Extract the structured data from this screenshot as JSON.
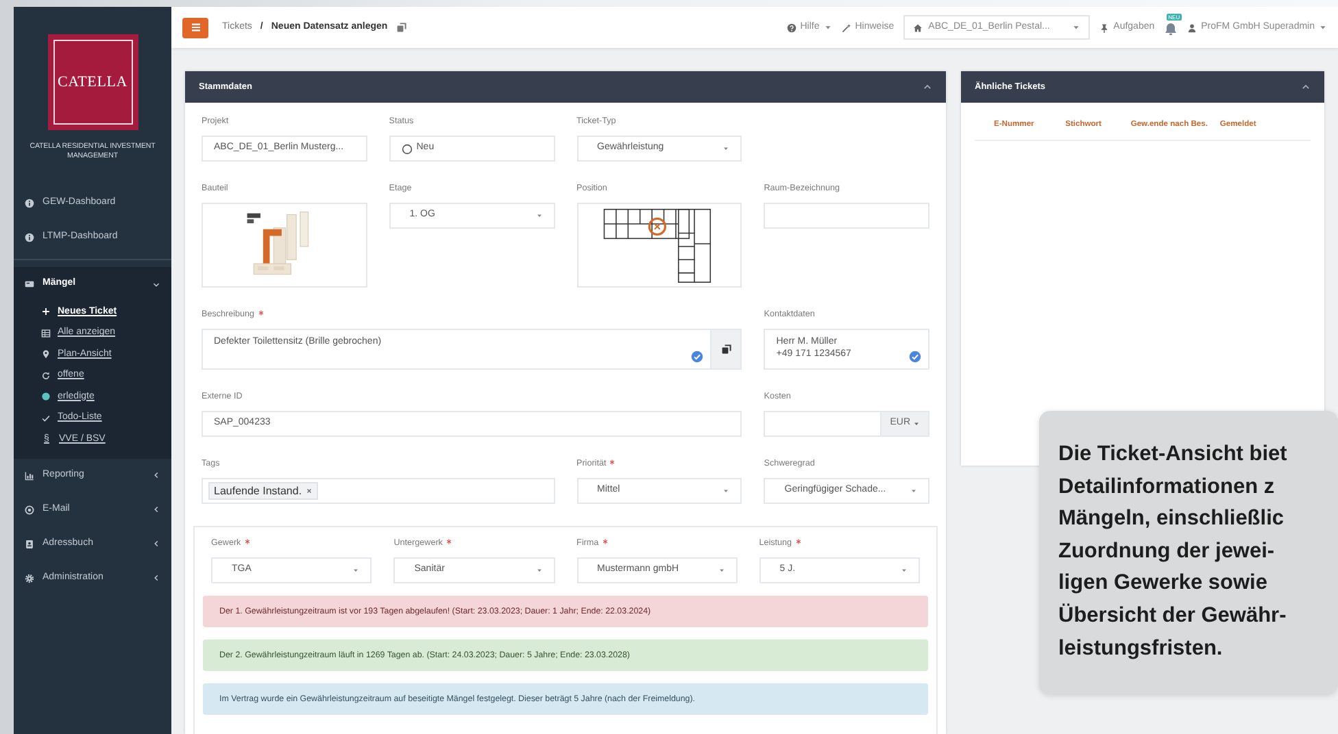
{
  "topbar": {
    "breadcrumb": {
      "parent": "Tickets",
      "separator": "/",
      "current": "Neuen Datensatz anlegen"
    },
    "help": "Hilfe",
    "hints": "Hinweise",
    "project": "ABC_DE_01_Berlin Pestal...",
    "tasks": "Aufgaben",
    "notification_badge": "NEU",
    "user": "ProFM GmbH Superadmin"
  },
  "sidebar": {
    "logo": "CATELLA",
    "company": "CATELLA RESIDENTIAL INVESTMENT MANAGEMENT",
    "items": [
      {
        "kind": "link",
        "label": "GEW-Dashboard"
      },
      {
        "kind": "link",
        "label": "LTMP-Dashboard"
      },
      {
        "kind": "group",
        "label": "Mängel",
        "expanded": true,
        "children": [
          {
            "label": "Neues Ticket",
            "selected": true
          },
          {
            "label": "Alle anzeigen",
            "selected": false
          },
          {
            "label": "Plan-Ansicht",
            "selected": false
          },
          {
            "label": "offene",
            "selected": false
          },
          {
            "label": "erledigte",
            "selected": false
          },
          {
            "label": "Todo-Liste",
            "selected": false
          },
          {
            "label": "VVE / BSV",
            "glyph": "§",
            "selected": false
          }
        ]
      },
      {
        "kind": "group",
        "label": "Reporting",
        "expanded": false
      },
      {
        "kind": "group",
        "label": "E-Mail",
        "expanded": false
      },
      {
        "kind": "group",
        "label": "Adressbuch",
        "expanded": false
      },
      {
        "kind": "group",
        "label": "Administration",
        "expanded": false
      }
    ]
  },
  "stammdaten": {
    "title": "Stammdaten",
    "rows": [
      {
        "kind": "three",
        "fields": [
          {
            "kind": "text",
            "label": "Projekt",
            "required": false,
            "value": "ABC_DE_01_Berlin Musterg..."
          },
          {
            "kind": "status",
            "label": "Status",
            "required": false,
            "value": "Neu"
          },
          {
            "kind": "select",
            "label": "Ticket-Typ",
            "required": false,
            "value": "Gewährleistung"
          }
        ]
      },
      {
        "kind": "four",
        "fields": [
          {
            "kind": "site_plan",
            "label": "Bauteil",
            "required": false
          },
          {
            "kind": "select",
            "label": "Etage",
            "required": false,
            "value": "1. OG"
          },
          {
            "kind": "floor_plan",
            "label": "Position",
            "required": false
          },
          {
            "kind": "text",
            "label": "Raum-Bezeichnung",
            "required": false
          }
        ]
      },
      {
        "kind": "wide",
        "fields": [
          {
            "kind": "textarea",
            "label": "Beschreibung",
            "required": true,
            "copy_button": true,
            "lines": [
              "Defekter Toilettensitz (Brille gebrochen)"
            ]
          },
          {
            "kind": "textarea",
            "label": "Kontaktdaten",
            "required": false,
            "copy_button": false,
            "lines": [
              "Herr M. Müller",
              "+49 171 1234567"
            ]
          }
        ]
      },
      {
        "kind": "wide",
        "fields": [
          {
            "kind": "text",
            "label": "Externe ID",
            "required": false,
            "value": "SAP_004233"
          },
          {
            "kind": "money",
            "label": "Kosten",
            "required": false,
            "currency": "EUR"
          }
        ]
      },
      {
        "kind": "half",
        "fields": [
          {
            "kind": "tags",
            "label": "Tags",
            "required": false,
            "tags": [
              "Laufende Instand."
            ]
          },
          {
            "kind": "select",
            "label": "Priorität",
            "required": true,
            "value": "Mittel"
          },
          {
            "kind": "select",
            "label": "Schweregrad",
            "required": false,
            "value": "Geringfügiger Schade..."
          }
        ]
      }
    ],
    "trade": {
      "fields": [
        {
          "kind": "select",
          "label": "Gewerk",
          "required": true,
          "value": "TGA"
        },
        {
          "kind": "select",
          "label": "Untergewerk",
          "required": true,
          "value": "Sanitär"
        },
        {
          "kind": "select",
          "label": "Firma",
          "required": true,
          "value": "Mustermann gmbH"
        },
        {
          "kind": "select",
          "label": "Leistung",
          "required": true,
          "value": "5 J."
        }
      ],
      "alerts": [
        {
          "kind": "danger",
          "text": "Der 1. Gewährleistungzeitraum ist vor 193 Tagen abgelaufen! (Start: 23.03.2023; Dauer: 1 Jahr; Ende: 22.03.2024)"
        },
        {
          "kind": "success",
          "text": "Der 2. Gewährleistungzeitraum läuft in 1269 Tagen ab. (Start: 24.03.2023; Dauer: 5 Jahre; Ende: 23.03.2028)"
        },
        {
          "kind": "info",
          "text": "Im Vertrag wurde ein Gewährleistungzeitraum auf beseitigte Mängel festgelegt. Dieser beträgt 5 Jahre (nach der Freimeldung)."
        }
      ]
    }
  },
  "similar_tickets": {
    "title": "Ähnliche Tickets",
    "columns": [
      "E-Nummer",
      "Stichwort",
      "Gew.ende nach Bes.",
      "Gemeldet"
    ]
  },
  "callout": {
    "lines": [
      "Die Ticket-Ansicht biet",
      "Detailinformationen z",
      "Mängeln, einschließlic",
      "Zuordnung der jewei-",
      "ligen Gewerke sowie",
      "Übersicht der Gewähr-",
      "leistungsfristen."
    ]
  }
}
